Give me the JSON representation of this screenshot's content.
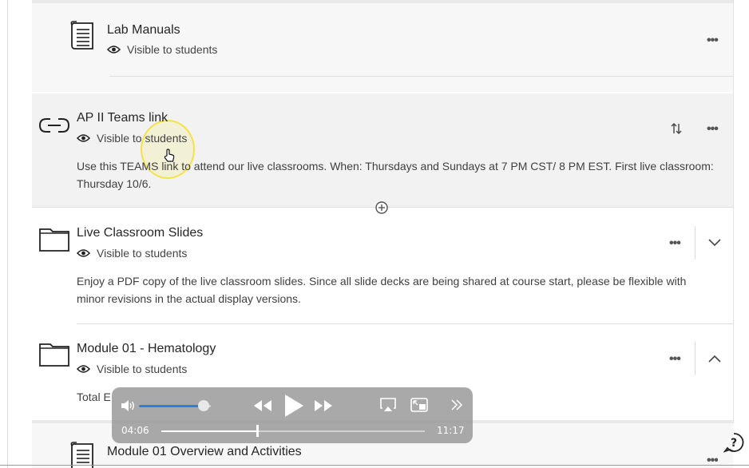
{
  "items": [
    {
      "title": "Lab Manuals",
      "visibility": "Visible to students"
    },
    {
      "title": "AP II Teams link",
      "visibility": "Visible to students",
      "description": "Use this TEAMS link to attend our live classrooms. When: Thursdays and Sundays at 7 PM CST/ 8 PM EST. First live classroom: Thursday 10/6."
    },
    {
      "title": "Live Classroom Slides",
      "visibility": "Visible to students",
      "description": "Enjoy a PDF copy of the live classroom slides. Since all slide decks are being shared at course start, please be flexible with minor revisions in the actual display versions."
    },
    {
      "title": "Module 01 - Hematology",
      "visibility": "Visible to students",
      "description": "Total E"
    },
    {
      "title": "Module 01 Overview and Activities"
    }
  ],
  "actions": {
    "more": "•••"
  },
  "player": {
    "current_time": "04:06",
    "duration": "11:17",
    "progress": 0.364,
    "volume": 0.9
  },
  "icons": {
    "document": "document-icon",
    "link": "link-icon",
    "folder": "folder-icon",
    "eye": "eye-icon",
    "reorder": "reorder-icon",
    "add": "add-icon",
    "help": "help-icon"
  },
  "colors": {
    "accent": "#2f7de0",
    "cursor_highlight": "#f3e24a"
  }
}
